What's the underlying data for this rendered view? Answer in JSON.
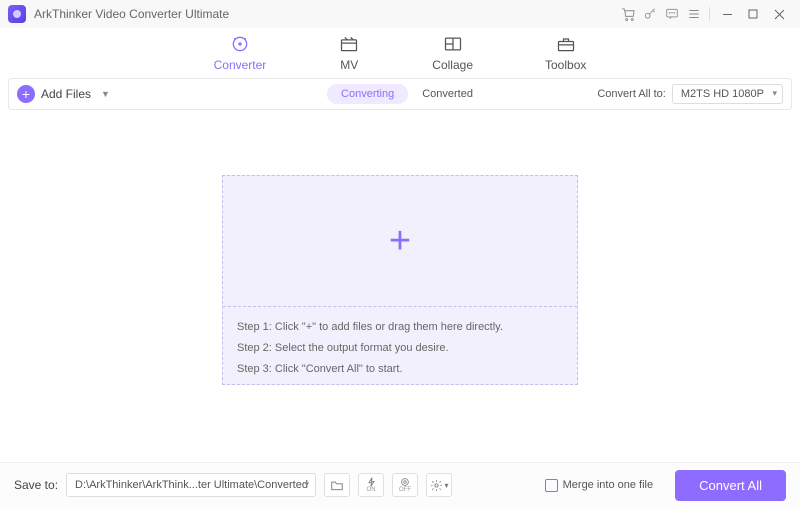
{
  "app": {
    "title": "ArkThinker Video Converter Ultimate"
  },
  "tabs": {
    "converter": "Converter",
    "mv": "MV",
    "collage": "Collage",
    "toolbox": "Toolbox"
  },
  "toolbar": {
    "add_files": "Add Files",
    "converting": "Converting",
    "converted": "Converted",
    "convert_all_to": "Convert All to:",
    "format_selected": "M2TS HD 1080P"
  },
  "dropzone": {
    "step1": "Step 1: Click \"+\" to add files or drag them here directly.",
    "step2": "Step 2: Select the output format you desire.",
    "step3": "Step 3: Click \"Convert All\" to start."
  },
  "footer": {
    "save_to": "Save to:",
    "path": "D:\\ArkThinker\\ArkThink...ter Ultimate\\Converted",
    "merge": "Merge into one file",
    "convert_all": "Convert All"
  }
}
